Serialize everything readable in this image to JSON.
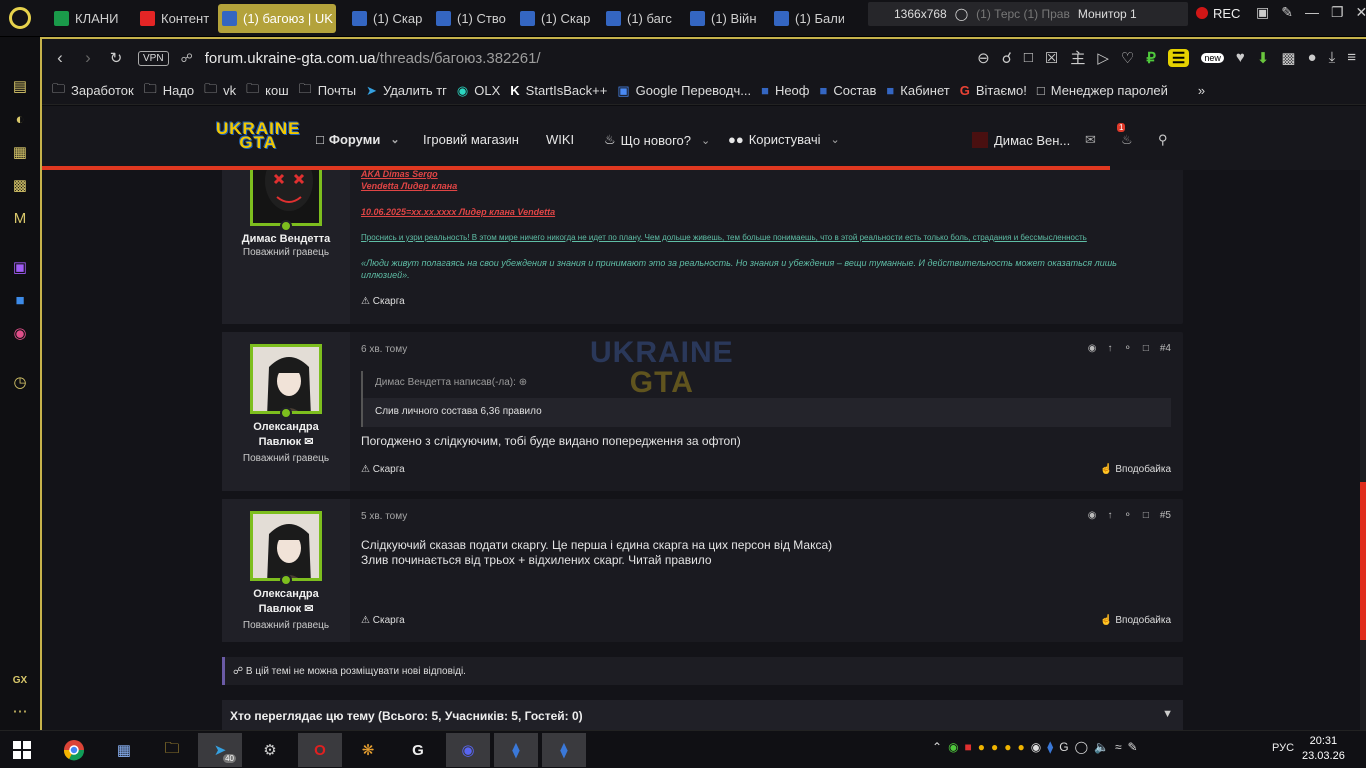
{
  "tabs": [
    {
      "label": "КЛАНИ",
      "color": "#1a9a4a"
    },
    {
      "label": "Контент",
      "color": "#e42525"
    },
    {
      "label": "(1) багоюз | UK",
      "color": "#3466c2",
      "active": true
    },
    {
      "label": "(1) Скар",
      "color": "#3466c2"
    },
    {
      "label": "(1) Ство",
      "color": "#3466c2"
    },
    {
      "label": "(1) Скар",
      "color": "#3466c2"
    },
    {
      "label": "(1) багс",
      "color": "#3466c2"
    },
    {
      "label": "(1) Війн",
      "color": "#3466c2"
    },
    {
      "label": "(1) Бали",
      "color": "#3466c2"
    }
  ],
  "overlay": {
    "resolution": "1366x768",
    "monitor": "Монитор 1",
    "rec": "REC",
    "hidden_tabs": "(1) Терс (1) Прав"
  },
  "address": {
    "vpn": "VPN",
    "url_host": "forum.ukraine-gta.com.ua",
    "url_path": "/threads/багоюз.382261/",
    "new_badge": "new"
  },
  "bookmarks": [
    "Заработок",
    "Надо",
    "vk",
    "кош",
    "Почты",
    "Удалить тг",
    "OLX",
    "StartIsBack++",
    "Google Переводч...",
    "Неоф",
    "Состав",
    "Кабинет",
    "Вітаємо!",
    "Менеджер паролей"
  ],
  "forum_nav": {
    "logo_top": "UKRAINE",
    "logo_bottom": "GTA",
    "forums": "Форуми",
    "shop": "Ігровий магазин",
    "wiki": "WIKI",
    "whats_new": "Що нового?",
    "users": "Користувачі",
    "current_user": "Димас Вен...",
    "notif_count": "1"
  },
  "post1": {
    "sig_red1": "AKA Dimas Sergo",
    "sig_red2": "Vendetta Лидер клана",
    "sig_red3": "10.06.2025=xx.xx.xxxx Лидер клана Vendetta",
    "sig_green": "Проснись и узри реальность! В этом мире ничего никогда не идет по плану. Чем дольше живешь, тем больше понимаешь, что в этой реальности есть только боль, страдания и бессмысленность",
    "sig_teal": "«Люди живут полагаясь на свои убеждения и знания и принимают это за реальность. Но знания и убеждения – вещи туманные. И действительность может оказаться лишь иллюзией».",
    "author": "Димас Вендетта",
    "role": "Поважний гравець",
    "report": "Скарга"
  },
  "post2": {
    "time": "6 хв. тому",
    "number": "#4",
    "author_line1": "Олександра",
    "author_line2": "Павлюк",
    "role": "Поважний гравець",
    "quote_header": "Димас Вендетта написав(-ла):",
    "quote_body": "Слив личного состава 6,36 правило",
    "body": "Погоджено з слідкуючим, тобі буде видано попередження за офтоп)",
    "report": "Скарга",
    "like": "Вподобайка"
  },
  "post3": {
    "time": "5 хв. тому",
    "number": "#5",
    "author_line1": "Олександра",
    "author_line2": "Павлюк",
    "role": "Поважний гравець",
    "body_line1": "Слідкуючий сказав подати скаргу. Це перша і єдина скарга на цих персон від Макса)",
    "body_line2": "Злив починається від трьох + відхилених скарг. Читай правило",
    "report": "Скарга",
    "like": "Вподобайка"
  },
  "locked_notice": "В цій темі не можна розміщувати нові відповіді.",
  "viewers": "Хто переглядає цю тему (Всього: 5, Учасників: 5, Гостей: 0)",
  "watermark": {
    "top": "UKRAINE",
    "bottom": "GTA"
  },
  "sidebar": {
    "gx": "GX"
  },
  "taskbar": {
    "telegram_badge": "40",
    "lang": "РУС",
    "time": "20:31",
    "date": "23.03.26"
  }
}
